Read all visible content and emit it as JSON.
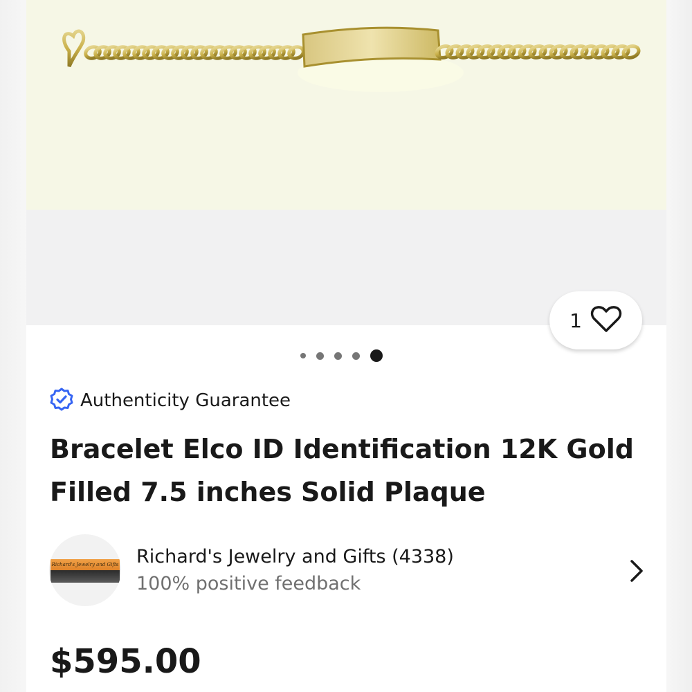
{
  "listing": {
    "title": "Bracelet Elco ID Identification 12K Gold Filled 7.5 inches Solid Plaque",
    "price": "$595.00"
  },
  "gallery": {
    "image_subject": "gold ID bracelet with curb chain and plaque",
    "total_images": 5,
    "active_index": 4,
    "watch_count": "1",
    "watch_icon": "heart-outline-icon"
  },
  "badge": {
    "label": "Authenticity Guarantee",
    "icon": "verified-check-badge-icon",
    "icon_color": "#3665f3"
  },
  "seller": {
    "name_and_score": "Richard's Jewelry and Gifts (4338)",
    "feedback": "100% positive feedback",
    "logo_text": "Richard's Jewelry and Gifts",
    "chevron_icon": "chevron-right-icon"
  },
  "colors": {
    "text_primary": "#191919",
    "text_secondary": "#707070",
    "accent": "#3665f3",
    "photo_bg": "#f6f7e6",
    "gold": "#c9b04a"
  }
}
